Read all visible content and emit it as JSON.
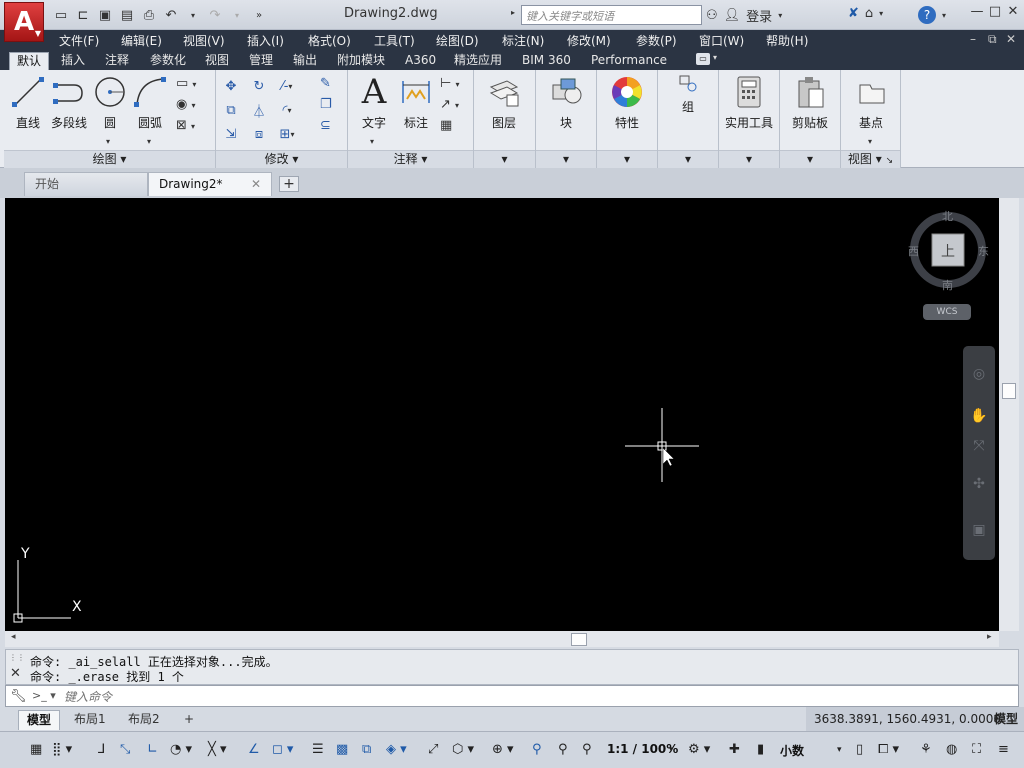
{
  "titlebar": {
    "doc_title": "Drawing2.dwg",
    "search_placeholder": "键入关键字或短语",
    "login_label": "登录",
    "help_label": "?"
  },
  "menubar": [
    "文件(F)",
    "编辑(E)",
    "视图(V)",
    "插入(I)",
    "格式(O)",
    "工具(T)",
    "绘图(D)",
    "标注(N)",
    "修改(M)",
    "参数(P)",
    "窗口(W)",
    "帮助(H)"
  ],
  "ribbon_tabs": [
    "默认",
    "插入",
    "注释",
    "参数化",
    "视图",
    "管理",
    "输出",
    "附加模块",
    "A360",
    "精选应用",
    "BIM 360",
    "Performance"
  ],
  "ribbon": {
    "draw": {
      "buttons": [
        "直线",
        "多段线",
        "圆",
        "圆弧"
      ],
      "panel_label": "绘图"
    },
    "modify": {
      "panel_label": "修改"
    },
    "annotation": {
      "buttons": [
        "文字",
        "标注"
      ],
      "panel_label": "注释"
    },
    "layers": {
      "label": "图层"
    },
    "block": {
      "label": "块"
    },
    "properties": {
      "label": "特性"
    },
    "group": {
      "label": "组"
    },
    "utilities": {
      "label": "实用工具"
    },
    "clipboard": {
      "label": "剪贴板"
    },
    "view": {
      "button": "基点",
      "panel_label": "视图"
    }
  },
  "file_tabs": {
    "start": "开始",
    "drawing": "Drawing2*",
    "add": "+"
  },
  "viewcube": {
    "north": "北",
    "south": "南",
    "east": "东",
    "west": "西",
    "face": "上",
    "wcs": "WCS"
  },
  "ucs": {
    "x_label": "X",
    "y_label": "Y"
  },
  "command": {
    "history": [
      "命令: _ai_selall 正在选择对象...完成。",
      "命令: _.erase 找到 1 个"
    ],
    "input_placeholder": "键入命令"
  },
  "layout_tabs": [
    "模型",
    "布局1",
    "布局2",
    "+"
  ],
  "coordinates": "3638.3891, 1560.4931, 0.0000",
  "model_label": "模型",
  "statusbar": {
    "scale": "1:1 / 100%",
    "units": "小数"
  },
  "colors": {
    "canvas": "#000000",
    "menubar": "#2b3443",
    "accent": "#1f5aa8",
    "app_red": "#c42020"
  }
}
